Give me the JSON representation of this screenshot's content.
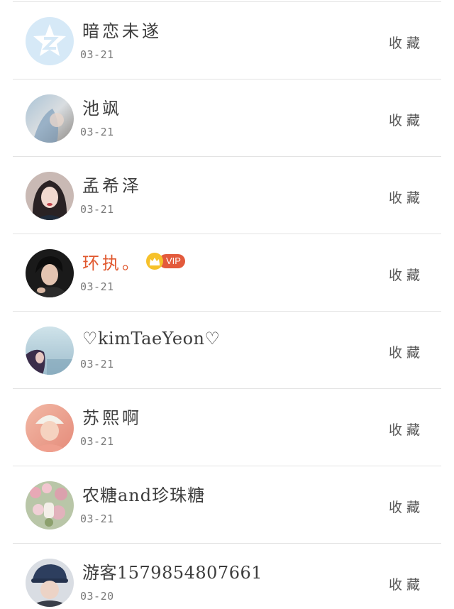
{
  "items": [
    {
      "name": "暗恋未遂",
      "date": "03-21",
      "action": "收藏",
      "avatar": "qzone-logo-icon",
      "vip": false
    },
    {
      "name": "池飒",
      "date": "03-21",
      "action": "收藏",
      "avatar": "user-photo",
      "vip": false
    },
    {
      "name": "孟希泽",
      "date": "03-21",
      "action": "收藏",
      "avatar": "user-photo",
      "vip": false
    },
    {
      "name": "环执。",
      "date": "03-21",
      "action": "收藏",
      "avatar": "user-photo",
      "vip": true,
      "vip_label": "VIP"
    },
    {
      "name": "♡kimTaeYeon♡",
      "date": "03-21",
      "action": "收藏",
      "avatar": "user-photo",
      "vip": false
    },
    {
      "name": "苏熙啊",
      "date": "03-21",
      "action": "收藏",
      "avatar": "user-photo",
      "vip": false
    },
    {
      "name": "农糖and珍珠糖",
      "date": "03-21",
      "action": "收藏",
      "avatar": "user-photo",
      "vip": false
    },
    {
      "name": "游客1579854807661",
      "date": "03-20",
      "action": "收藏",
      "avatar": "user-photo",
      "vip": false
    }
  ],
  "colors": {
    "name": "#3d3d3d",
    "vip_name": "#e0582e",
    "vip_badge": "#e35a3c",
    "vip_crown": "#f6c12a",
    "date": "#7a7a7a",
    "action": "#555555",
    "divider": "#e3e3e3"
  }
}
